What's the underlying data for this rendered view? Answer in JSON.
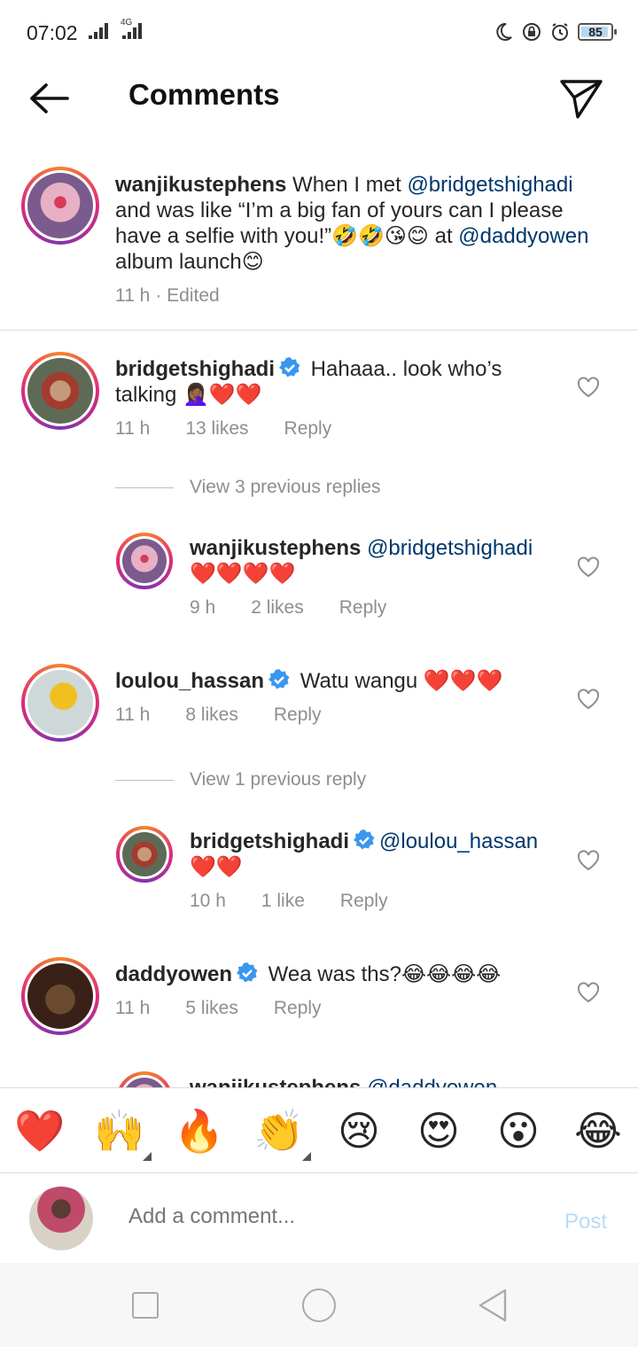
{
  "status_bar": {
    "time": "07:02",
    "network": "4G",
    "battery": "85"
  },
  "header": {
    "title": "Comments"
  },
  "caption": {
    "username": "wanjikustephens",
    "text_before": " When  I met ",
    "mention1": "@bridgetshighadi",
    "text_mid": "  and was like “I’m a big fan of yours can  I please have a selfie with you!”🤣🤣😘😊 at ",
    "mention2": "@daddyowen",
    "text_after": "  album launch😊",
    "time": "11 h",
    "edited": "· Edited"
  },
  "comments": [
    {
      "username": "bridgetshighadi",
      "verified": true,
      "text": " Hahaaa.. look who’s talking 🤦🏾‍♀️❤️❤️",
      "time": "11 h",
      "likes": "13 likes",
      "reply": "Reply"
    },
    {
      "username": "wanjikustephens",
      "verified": false,
      "mention": "@bridgetshighadi",
      "text": " ❤️❤️❤️❤️",
      "time": "9 h",
      "likes": "2 likes",
      "reply": "Reply"
    },
    {
      "username": "loulou_hassan",
      "verified": true,
      "text": " Watu wangu ❤️❤️❤️",
      "time": "11 h",
      "likes": "8 likes",
      "reply": "Reply"
    },
    {
      "username": "bridgetshighadi",
      "verified": true,
      "mention": "@loulou_hassan",
      "text": " ❤️❤️",
      "time": "10 h",
      "likes": "1 like",
      "reply": "Reply"
    },
    {
      "username": "daddyowen",
      "verified": true,
      "text": " Wea was ths?😂😂😂😂",
      "time": "11 h",
      "likes": "5 likes",
      "reply": "Reply"
    }
  ],
  "view_replies": [
    "View 3 previous replies",
    "View 1 previous reply"
  ],
  "peek": {
    "username": "wanjikustephens",
    "mention": "@daddyowen"
  },
  "emoji_bar": [
    "❤️",
    "🙌",
    "🔥",
    "👏",
    "😢",
    "😍",
    "😮",
    "😂"
  ],
  "composer": {
    "placeholder": "Add a comment...",
    "post": "Post"
  },
  "colors": {
    "mention": "#00376b",
    "meta": "#8e8e8e",
    "post": "#b6dcf7",
    "verified": "#3897f0"
  }
}
